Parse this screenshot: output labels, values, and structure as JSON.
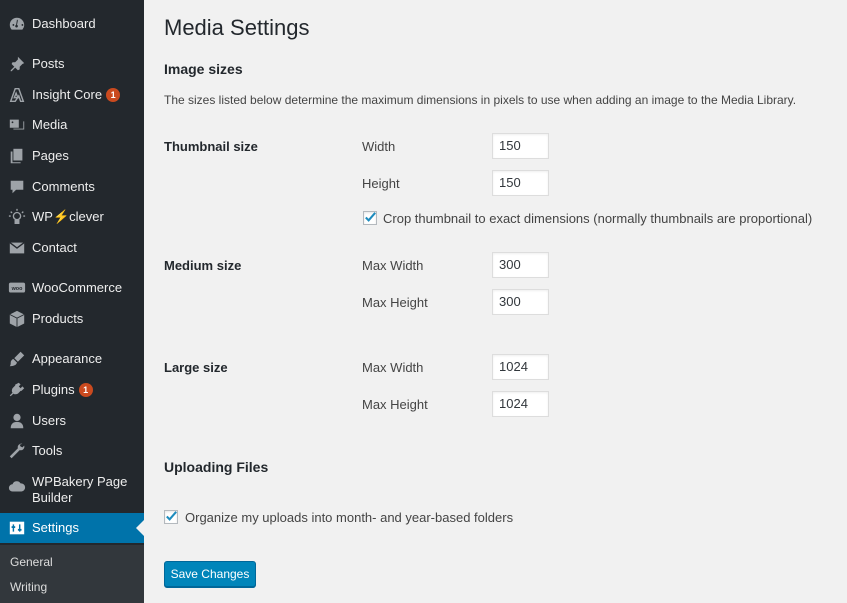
{
  "sidebar": {
    "items": [
      {
        "label": "Dashboard",
        "icon": "dashboard-icon"
      },
      {
        "label": "Posts",
        "icon": "pin-icon"
      },
      {
        "label": "Insight Core",
        "icon": "insight-core-icon",
        "badge": "1"
      },
      {
        "label": "Media",
        "icon": "media-icon"
      },
      {
        "label": "Pages",
        "icon": "pages-icon"
      },
      {
        "label": "Comments",
        "icon": "comment-icon"
      },
      {
        "label": "WP⚡clever",
        "icon": "bulb-icon"
      },
      {
        "label": "Contact",
        "icon": "mail-icon"
      },
      {
        "label": "WooCommerce",
        "icon": "woocommerce-icon"
      },
      {
        "label": "Products",
        "icon": "box-icon"
      },
      {
        "label": "Appearance",
        "icon": "brush-icon"
      },
      {
        "label": "Plugins",
        "icon": "plug-icon",
        "badge": "1"
      },
      {
        "label": "Users",
        "icon": "user-icon"
      },
      {
        "label": "Tools",
        "icon": "wrench-icon"
      },
      {
        "label": "WPBakery Page Builder",
        "icon": "cloud-icon"
      },
      {
        "label": "Settings",
        "icon": "settings-icon",
        "active": true
      }
    ],
    "submenu": [
      "General",
      "Writing"
    ]
  },
  "page": {
    "title": "Media Settings",
    "image_sizes": {
      "heading": "Image sizes",
      "description": "The sizes listed below determine the maximum dimensions in pixels to use when adding an image to the Media Library.",
      "thumbnail": {
        "label": "Thumbnail size",
        "width_label": "Width",
        "width_value": "150",
        "height_label": "Height",
        "height_value": "150",
        "crop_label": "Crop thumbnail to exact dimensions (normally thumbnails are proportional)",
        "crop_checked": true
      },
      "medium": {
        "label": "Medium size",
        "width_label": "Max Width",
        "width_value": "300",
        "height_label": "Max Height",
        "height_value": "300"
      },
      "large": {
        "label": "Large size",
        "width_label": "Max Width",
        "width_value": "1024",
        "height_label": "Max Height",
        "height_value": "1024"
      }
    },
    "uploading": {
      "heading": "Uploading Files",
      "organize_label": "Organize my uploads into month- and year-based folders",
      "organize_checked": true
    },
    "save_label": "Save Changes"
  },
  "colors": {
    "sidebar_bg": "#23282d",
    "submenu_bg": "#32373c",
    "accent": "#0073aa",
    "button": "#0085ba",
    "badge": "#ca4a1f",
    "page_bg": "#f1f1f1"
  }
}
